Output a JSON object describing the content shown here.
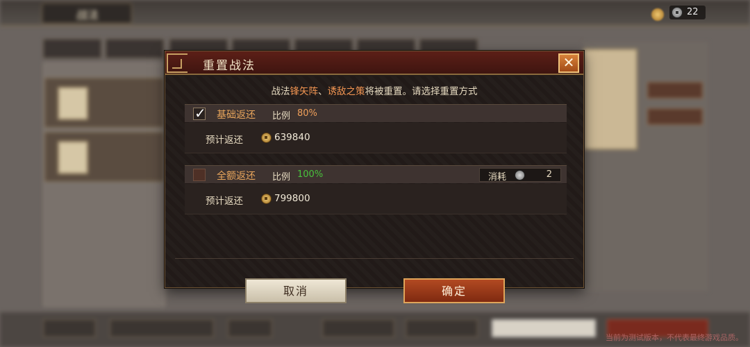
{
  "background": {
    "back_title": "战法",
    "tabs": [
      "",
      "",
      "",
      "",
      "",
      "",
      ""
    ],
    "currency": {
      "icon": "silver-coin-icon",
      "value": "22"
    },
    "watermark": "当前为测试版本，不代表最终游戏品质。"
  },
  "modal": {
    "title": "重置战法",
    "close_label": "✕",
    "message": {
      "prefix": "战法",
      "skill_one": "锋矢阵",
      "separator": "、",
      "skill_two": "诱敌之策",
      "suffix": "将被重置。请选择重置方式"
    },
    "options": [
      {
        "name": "基础返还",
        "ratio_label": "比例",
        "ratio_value": "80%",
        "checked": true,
        "refund_label": "预计返还",
        "refund_value": "639840"
      },
      {
        "name": "全额返还",
        "ratio_label": "比例",
        "ratio_value": "100%",
        "checked": false,
        "cost_label": "消耗",
        "cost_value": "2",
        "refund_label": "预计返还",
        "refund_value": "799800"
      }
    ],
    "cancel_label": "取消",
    "confirm_label": "确定"
  },
  "colors": {
    "highlight": "#f29552",
    "green": "#49c23c",
    "header": "#5c1f17",
    "confirm": "#b24a22"
  }
}
